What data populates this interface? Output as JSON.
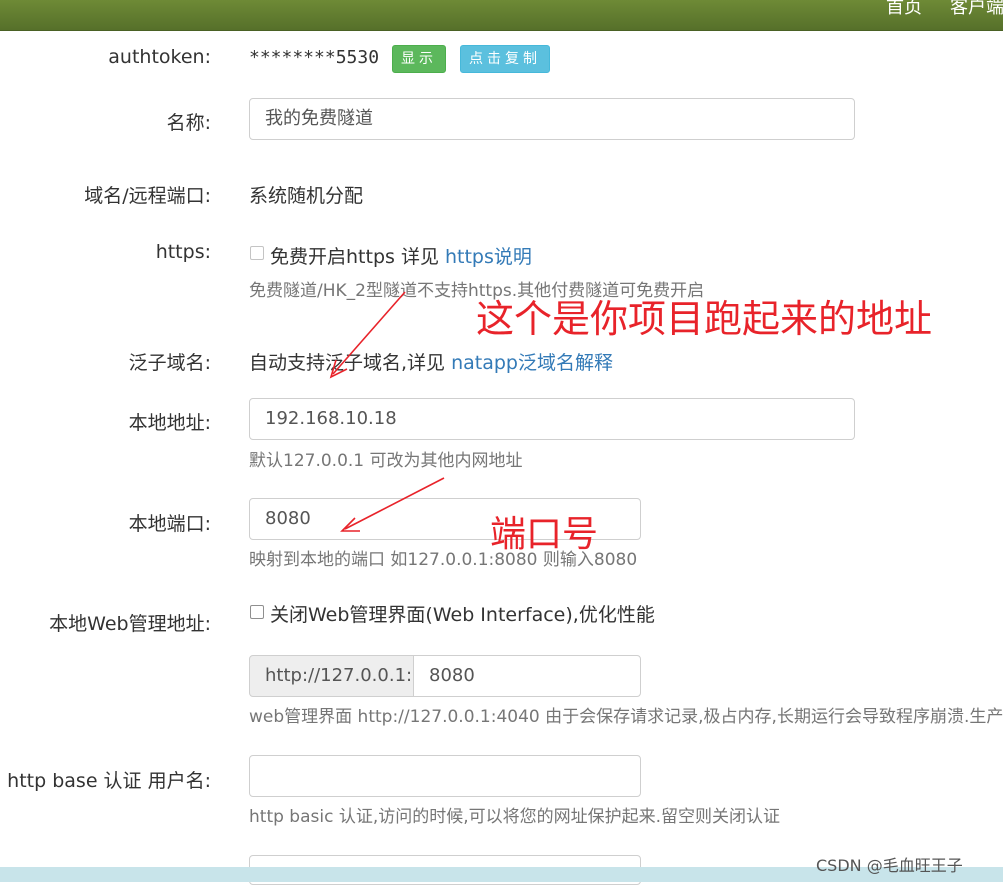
{
  "nav": {
    "items": [
      "首页",
      "客户端"
    ]
  },
  "authtoken": {
    "label": "authtoken:",
    "value": "********5530",
    "show_btn": "显示",
    "copy_btn": "点击复制"
  },
  "name": {
    "label": "名称:",
    "value": "我的免费隧道"
  },
  "domain": {
    "label": "域名/远程端口:",
    "value": "系统随机分配"
  },
  "https": {
    "label": "https:",
    "checkbox_text": "免费开启https 详见 ",
    "link": "https说明",
    "help": "免费隧道/HK_2型隧道不支持https.其他付费隧道可免费开启"
  },
  "wildcard": {
    "label": "泛子域名:",
    "text": "自动支持泛子域名,详见 ",
    "link": "natapp泛域名解释"
  },
  "local_addr": {
    "label": "本地地址:",
    "value": "192.168.10.18",
    "help": "默认127.0.0.1 可改为其他内网地址"
  },
  "local_port": {
    "label": "本地端口:",
    "value": "8080",
    "help": "映射到本地的端口 如127.0.0.1:8080 则输入8080"
  },
  "web_admin": {
    "label": "本地Web管理地址:",
    "checkbox_text": "关闭Web管理界面(Web Interface),优化性能",
    "prefix": "http://127.0.0.1:",
    "port": "8080",
    "help": "web管理界面 http://127.0.0.1:4040 由于会保存请求记录,极占内存,长期运行会导致程序崩溃.生产"
  },
  "http_auth": {
    "label": "http base 认证 用户名:",
    "value": "",
    "help": "http basic 认证,访问的时候,可以将您的网址保护起来.留空则关闭认证"
  },
  "annotations": {
    "address_note": "这个是你项目跑起来的地址",
    "port_note": "端口号"
  },
  "watermark": "CSDN @毛血旺王子",
  "colors": {
    "topbar": "#5f7a2f",
    "show_btn": "#5cb85c",
    "copy_btn": "#5bc0de",
    "annotation": "#e8232a",
    "link": "#337ab7"
  }
}
